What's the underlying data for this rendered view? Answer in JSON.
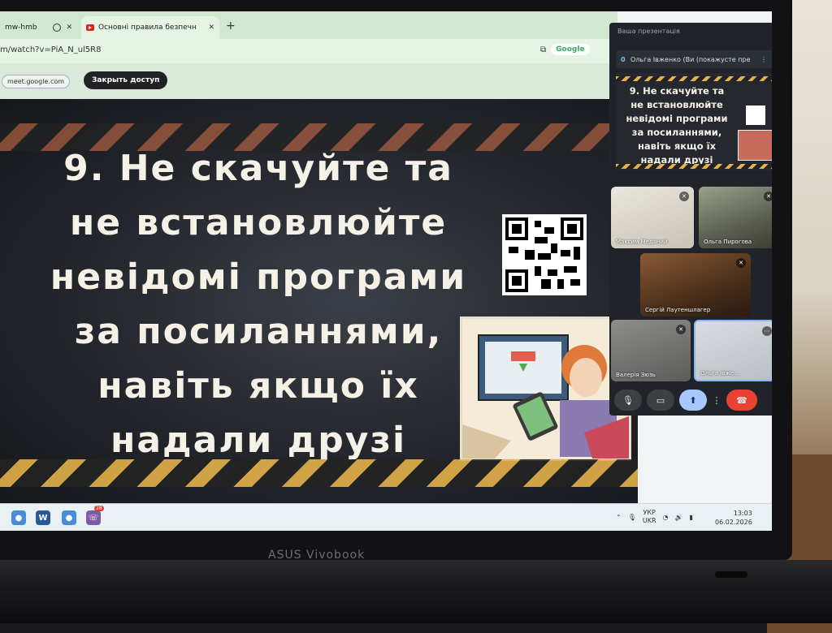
{
  "browser": {
    "tabs": [
      {
        "label": "mw-hmb"
      },
      {
        "label": "Основні правила безпечн"
      }
    ],
    "url": "m/watch?v=PiA_N_ul5R8",
    "google_label": "Google"
  },
  "meet_bar": {
    "meet_url": "meet.google.com",
    "share_button": "Закрыть доступ"
  },
  "slide": {
    "lines": [
      "9. Не скачуйте та",
      "не встановлюйте",
      "невідомі програми",
      "за посиланнями,",
      "навіть якщо їх",
      "надали друзі"
    ]
  },
  "meet_panel": {
    "header": "Ваша презентація",
    "presenter_badge": "0",
    "presenter_name": "Ольга Івженко (Ви (покажусте пре",
    "preview_text": "9. Не скачуйте та не встановлюйте невідомі програми за посиланнями, навіть якщо їх надали друзі",
    "participants": [
      {
        "name": "Максим Медяний"
      },
      {
        "name": "Ольга Пирогова"
      },
      {
        "name": "Сергій Лаутеншлагер"
      },
      {
        "name": "Валерія Зюзь"
      },
      {
        "name": "Ольга Івже..."
      }
    ]
  },
  "tray": {
    "lang_top": "УКР",
    "lang_bottom": "UKR",
    "time": "13:03",
    "date": "06.02.2026"
  },
  "laptop": {
    "brand": "ASUS Vivobook"
  },
  "taskbar": {
    "notification_count": "28"
  },
  "colors": {
    "slide_text": "#f5f1e6",
    "stripe_yellow": "#e4b14a",
    "end_call": "#e94235",
    "present_active": "#a8c7fa"
  }
}
